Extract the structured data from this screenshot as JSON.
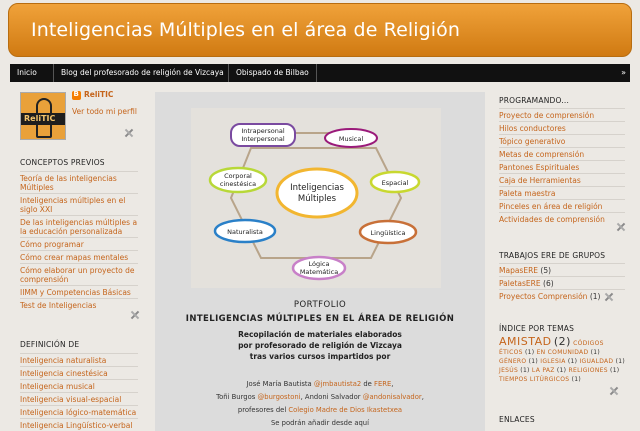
{
  "header": {
    "title": "Inteligencias Múltiples en el área de Religión"
  },
  "nav": {
    "tabs": [
      "Inicio",
      "Blog del profesorado de religión de Vizcaya",
      "Obispado de Bilbao"
    ],
    "more": "»"
  },
  "profile": {
    "name": "ReliTIC",
    "link": "Ver todo mi perfil",
    "logo_text": "ReliTIC"
  },
  "left": {
    "conceptos_title": "CONCEPTOS PREVIOS",
    "conceptos": [
      "Teoría de las inteligencias Múltiples",
      "Inteligencias múltiples en el siglo XXI",
      "De las inteligencias múltiples a la educación personalizada",
      "Cómo programar",
      "Cómo crear mapas mentales",
      "Cómo elaborar un proyecto de comprensión",
      "IIMM y Competencias Básicas",
      "Test de Inteligencias"
    ],
    "definicion_title": "DEFINICIÓN DE",
    "definicion": [
      "Inteligencia naturalista",
      "Inteligencia cinestésica",
      "Inteligencia musical",
      "Inteligencia visual-espacial",
      "Inteligencia lógico-matemática",
      "Inteligencia Lingüístico-verbal"
    ]
  },
  "diagram": {
    "center": "Inteligencias Múltiples",
    "nodes": [
      "Intrapersonal Interpersonal",
      "Musical",
      "Corporal cinestésica",
      "Espacial",
      "Naturalista",
      "Lingüística",
      "Lógica Matemática"
    ]
  },
  "post": {
    "line1": "PORTFOLIO",
    "line2": "INTELIGENCIAS MÚLTIPLES EN EL ÁREA DE RELIGIÓN",
    "line3": "Recopilación de materiales elaborados",
    "line4": "por profesorado de religión de Vizcaya",
    "line5": "tras varios cursos impartidos por",
    "credit1_a": "José María Bautista ",
    "credit1_b": "@jmbautista2",
    "credit1_c": " de ",
    "credit1_d": "FERE",
    "credit1_e": ",",
    "credit2_a": "Toñi Burgos ",
    "credit2_b": "@burgostoni",
    "credit2_c": ", Andoni Salvador ",
    "credit2_d": "@andonisalvador",
    "credit2_e": ",",
    "credit3_a": "profesores del ",
    "credit3_b": "Colegio Madre de Dios Ikastetxea",
    "credit4": "Se podrán añadir desde aquí"
  },
  "right": {
    "programando_title": "PROGRAMANDO...",
    "programando": [
      "Proyecto de comprensión",
      "Hilos conductores",
      "Tópico generativo",
      "Metas de comprensión",
      "Pantones Espirituales",
      "Caja de Herramientas",
      "Paleta maestra",
      "Pinceles en área de religión",
      "Actividades de comprensión"
    ],
    "trabajos_title": "TRABAJOS ERE DE GRUPOS",
    "trabajos": [
      {
        "label": "MapasERE",
        "count": "(5)"
      },
      {
        "label": "PaletasERE",
        "count": "(6)"
      },
      {
        "label": "Proyectos Comprensión",
        "count": "(1)"
      }
    ],
    "indice_title": "ÍNDICE POR TEMAS",
    "tags": {
      "amistad": "AMISTAD",
      "amistad_n": "(2)",
      "rest": "CÓDIGOS ÉTICOS",
      "n1": "(1)",
      "t2": "EN COMUNIDAD",
      "n2": "(1)",
      "t3": "GÉNERO",
      "n3": "(1)",
      "t4": "IGLESIA",
      "n4": "(1)",
      "t5": "IGUALDAD",
      "n5": "(1)",
      "t6": "JESÚS",
      "n6": "(1)",
      "t7": "LA PAZ",
      "n7": "(1)",
      "t8": "RELIGIONES",
      "n8": "(1)",
      "t9": "TIEMPOS LITÚRGICOS",
      "n9": "(1)"
    },
    "enlaces_title": "ENLACES"
  }
}
